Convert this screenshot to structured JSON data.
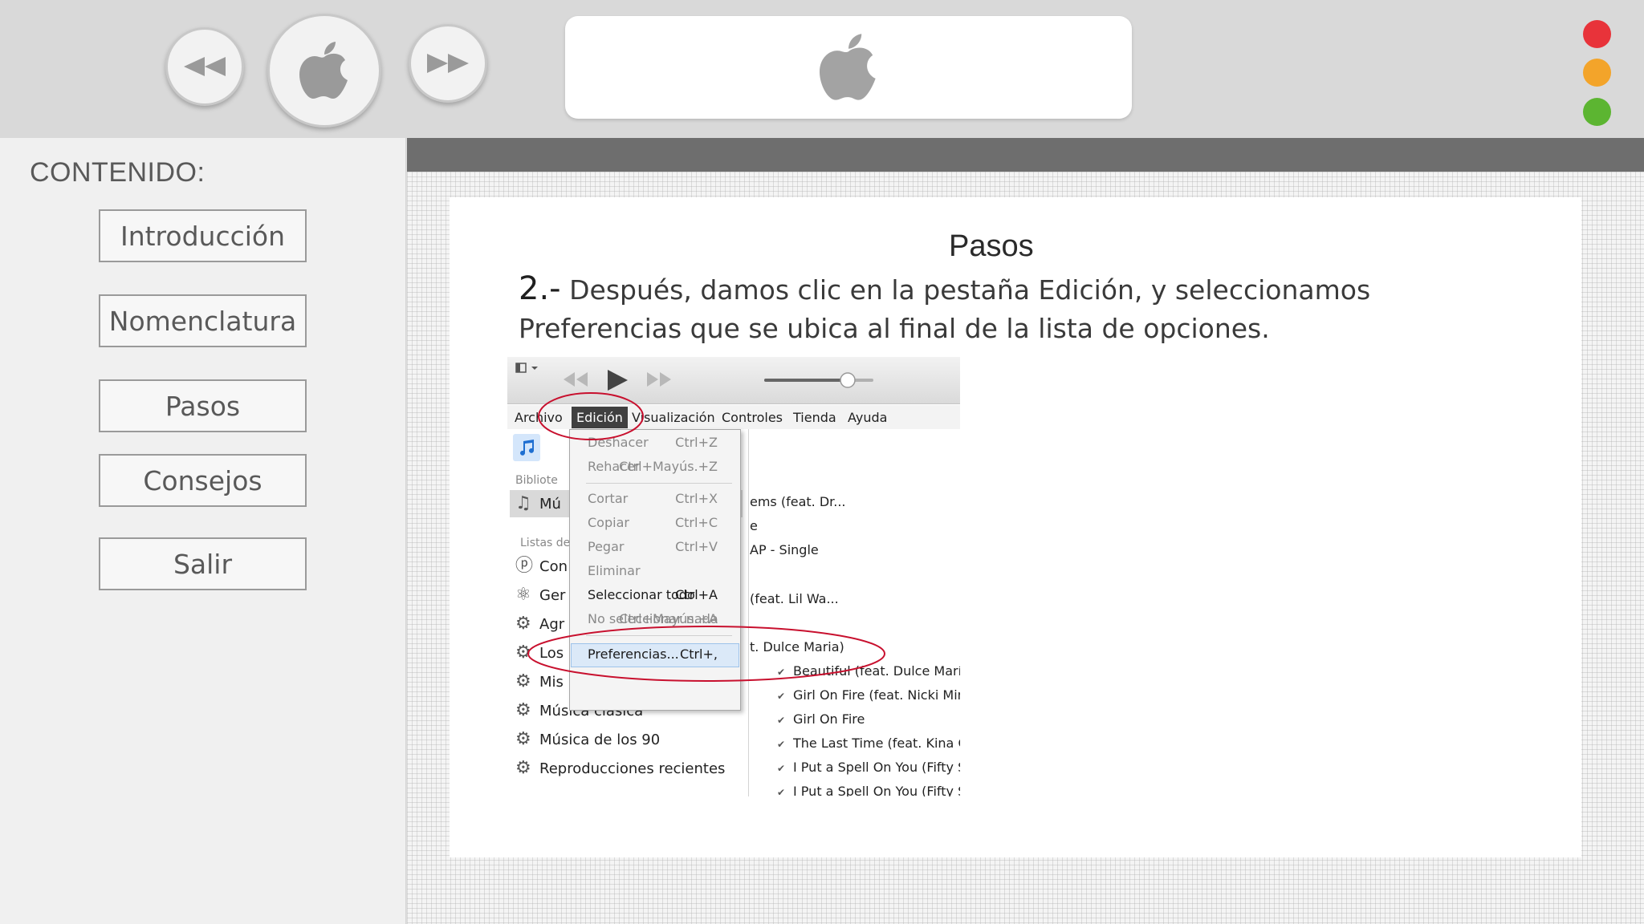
{
  "colors": {
    "dot_red": "#e8333a",
    "dot_orange": "#f3a42a",
    "dot_green": "#5cb531",
    "annotation": "#c8102e"
  },
  "topbar": {
    "rewind_icon": "rewind-icon",
    "home_icon": "apple-logo-icon",
    "forward_icon": "fast-forward-icon",
    "screen_icon": "apple-logo-icon"
  },
  "sidebar": {
    "heading": "CONTENIDO:",
    "items": [
      {
        "label": "Introducción"
      },
      {
        "label": "Nomenclatura"
      },
      {
        "label": "Pasos"
      },
      {
        "label": "Consejos"
      },
      {
        "label": "Salir"
      }
    ]
  },
  "main": {
    "title": "Pasos",
    "step_number": "2.-",
    "step_text": "Después, damos clic en la pestaña Edición, y seleccionamos Preferencias que se ubica al final de la lista de opciones."
  },
  "itunes": {
    "menu": [
      "Archivo",
      "Edición",
      "Visualización",
      "Controles",
      "Tienda",
      "Ayuda"
    ],
    "library_label": "Bibliote",
    "music_label": "Mú",
    "playlists_label": "Listas de",
    "left_items": [
      "Con",
      "Ger",
      "Agr",
      "Los",
      "Mis preferidas",
      "Música clásica",
      "Música de los 90",
      "Reproducciones recientes"
    ],
    "dropdown": [
      {
        "label": "Deshacer",
        "shortcut": "Ctrl+Z"
      },
      {
        "label": "Rehacer",
        "shortcut": "Ctrl+Mayús.+Z"
      },
      {
        "label": "Cortar",
        "shortcut": "Ctrl+X"
      },
      {
        "label": "Copiar",
        "shortcut": "Ctrl+C"
      },
      {
        "label": "Pegar",
        "shortcut": "Ctrl+V"
      },
      {
        "label": "Eliminar",
        "shortcut": ""
      },
      {
        "label": "Seleccionar todo",
        "shortcut": "Ctrl+A"
      },
      {
        "label": "No seleccionar nada",
        "shortcut": "Ctrl+Mayús.+A"
      },
      {
        "label": "Preferencias...",
        "shortcut": "Ctrl+,"
      }
    ],
    "songs_partial": [
      "ems (feat. Dr...",
      "e",
      "AP - Single",
      "(feat. Lil Wa...",
      "t. Dulce Maria)"
    ],
    "songs": [
      "Beautiful (feat. Dulce María)",
      "Girl On Fire (feat. Nicki Min",
      "Girl On Fire",
      "The Last Time (feat. Kina Gra",
      "I Put a Spell On You (Fifty S",
      "I Put a Spell On You (Fifty S"
    ]
  }
}
